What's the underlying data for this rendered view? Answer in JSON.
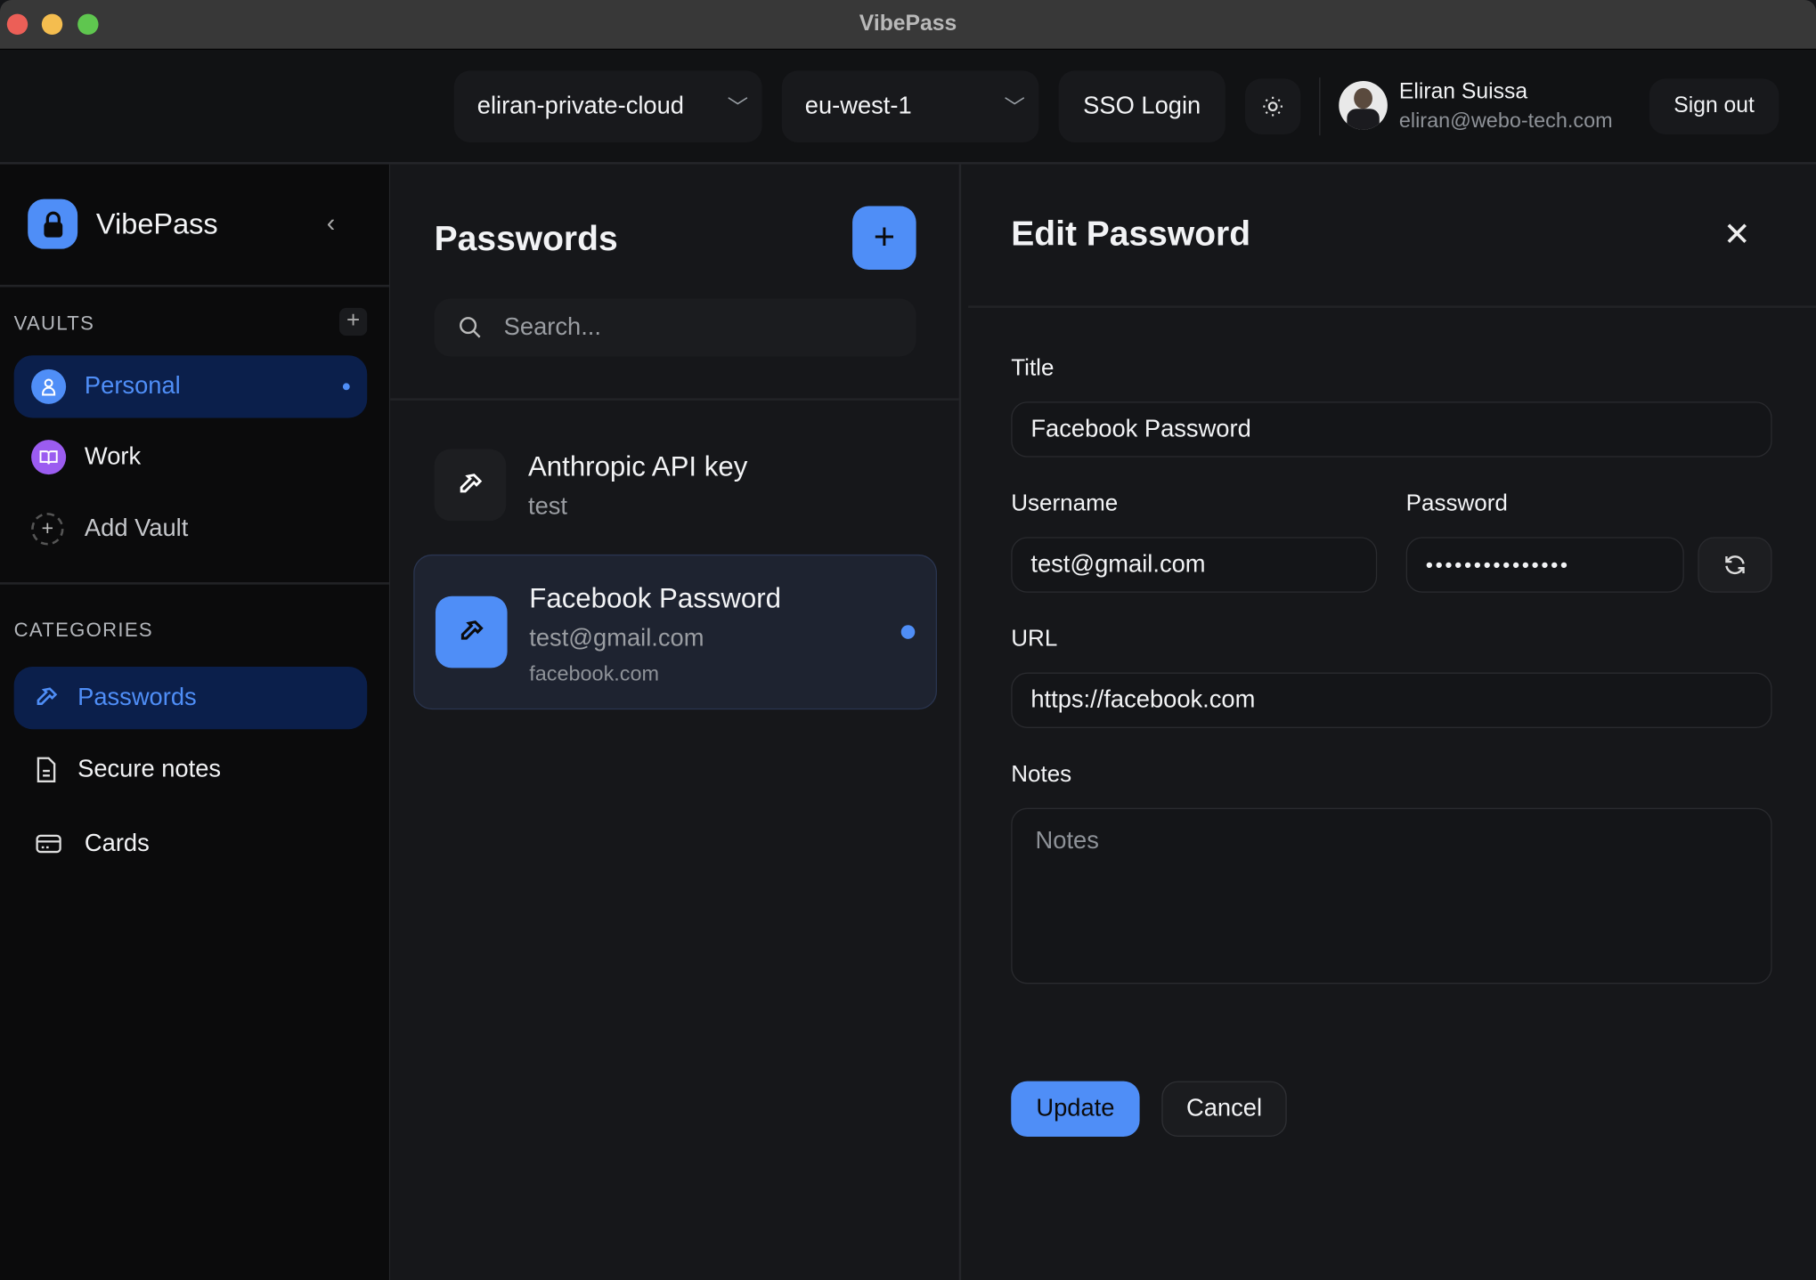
{
  "window": {
    "title": "VibePass"
  },
  "topbar": {
    "cloud_select": "eliran-private-cloud",
    "region_select": "eu-west-1",
    "sso_label": "SSO Login",
    "theme_icon": "sun-icon",
    "user": {
      "name": "Eliran Suissa",
      "email": "eliran@webo-tech.com"
    },
    "sign_out_label": "Sign out"
  },
  "sidebar": {
    "brand": "VibePass",
    "vaults_label": "VAULTS",
    "vaults": [
      {
        "label": "Personal",
        "icon": "user-icon",
        "color": "#4f8ef7",
        "active": true
      },
      {
        "label": "Work",
        "icon": "book-icon",
        "color": "#9b5cf0",
        "active": false
      }
    ],
    "add_vault_label": "Add Vault",
    "categories_label": "CATEGORIES",
    "categories": [
      {
        "label": "Passwords",
        "icon": "key-icon",
        "active": true
      },
      {
        "label": "Secure notes",
        "icon": "document-icon",
        "active": false
      },
      {
        "label": "Cards",
        "icon": "card-icon",
        "active": false
      }
    ]
  },
  "list": {
    "title": "Passwords",
    "search_placeholder": "Search...",
    "items": [
      {
        "title": "Anthropic API key",
        "subtitle": "test"
      },
      {
        "title": "Facebook Password",
        "subtitle": "test@gmail.com",
        "url": "facebook.com",
        "selected": true
      }
    ]
  },
  "editor": {
    "title": "Edit Password",
    "title_label": "Title",
    "title_value": "Facebook Password",
    "username_label": "Username",
    "username_value": "test@gmail.com",
    "password_label": "Password",
    "password_value": "•••••••••••••••",
    "url_label": "URL",
    "url_value": "https://facebook.com",
    "notes_label": "Notes",
    "notes_placeholder": "Notes",
    "update_label": "Update",
    "cancel_label": "Cancel"
  },
  "colors": {
    "accent": "#4f8ef7",
    "active_bg": "#0b1f4b"
  }
}
